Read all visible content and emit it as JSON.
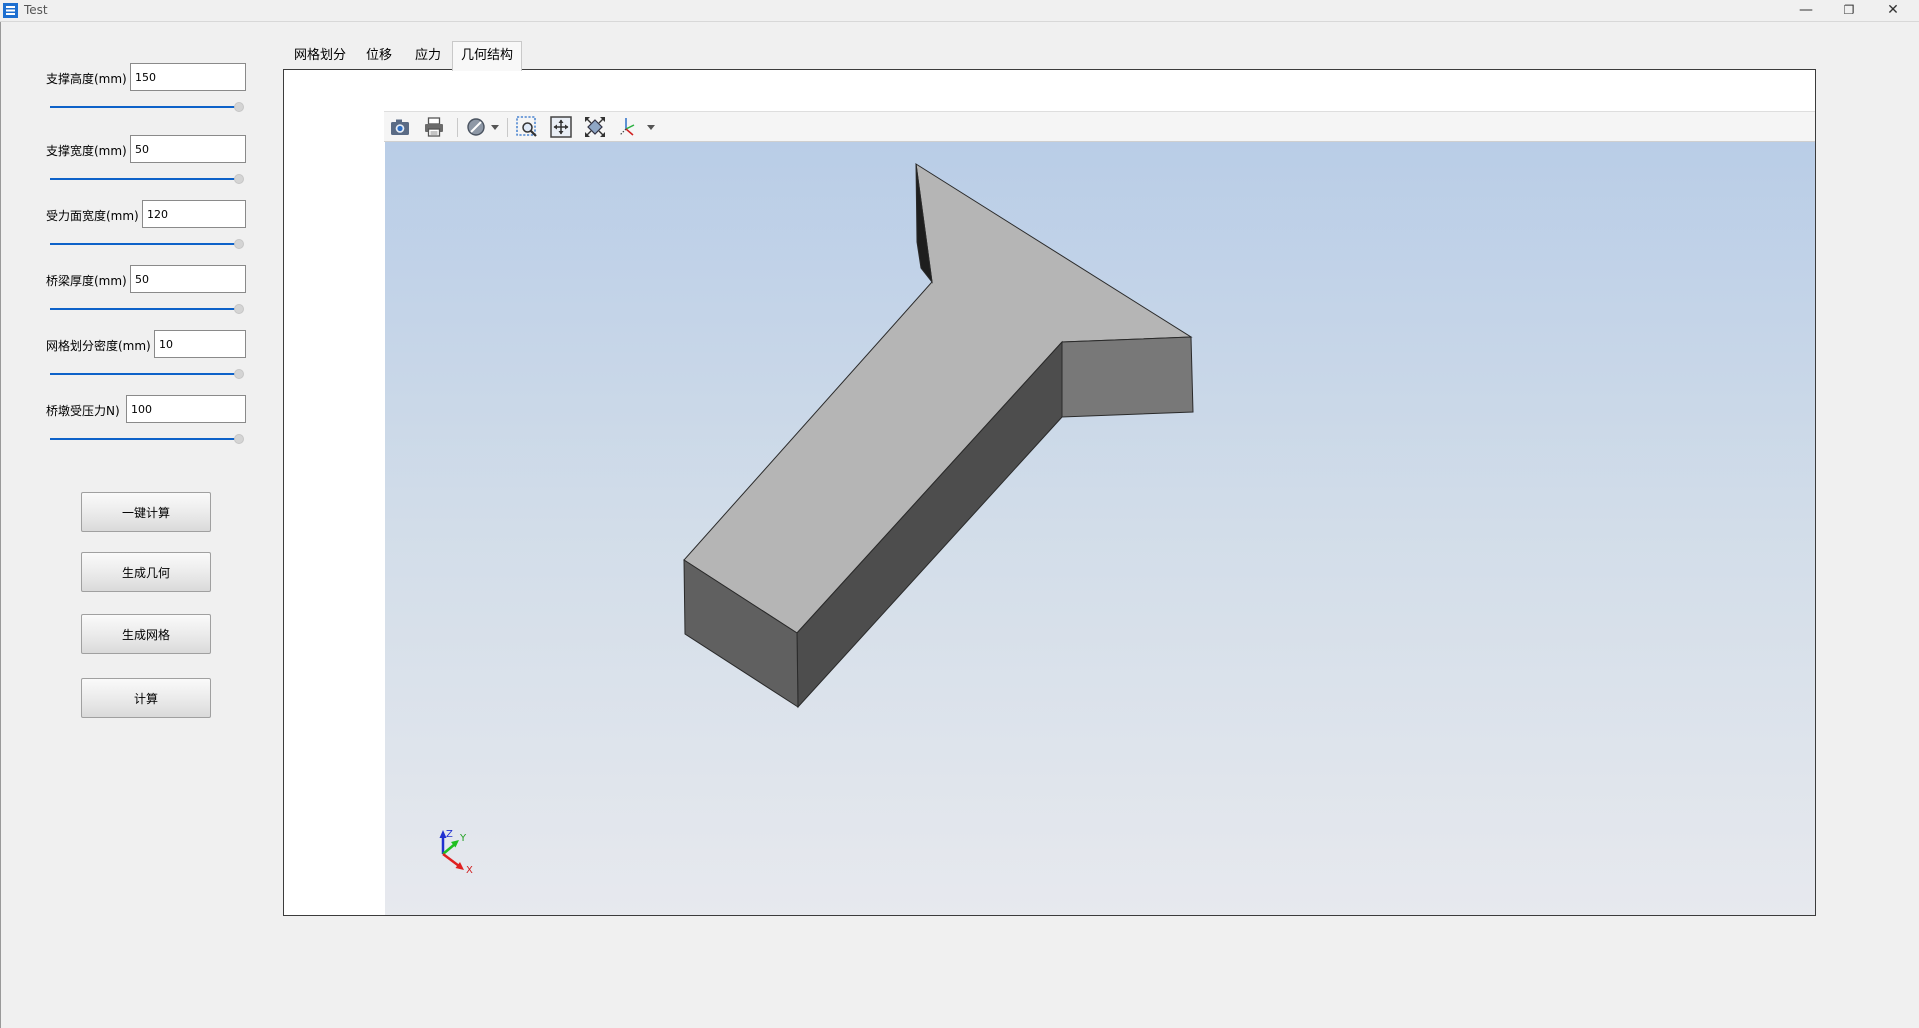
{
  "window": {
    "title": "Test",
    "controls": {
      "minimize": "—",
      "restore": "❐",
      "close": "✕"
    }
  },
  "params": [
    {
      "label": "支撑高度(mm)",
      "value": "150",
      "slider_fraction": 1.0
    },
    {
      "label": "支撑宽度(mm)",
      "value": "50",
      "slider_fraction": 1.0
    },
    {
      "label": "受力面宽度(mm)",
      "value": "120",
      "slider_fraction": 1.0
    },
    {
      "label": "桥梁厚度(mm)",
      "value": "50",
      "slider_fraction": 1.0
    },
    {
      "label": "网格划分密度(mm)",
      "value": "10",
      "slider_fraction": 1.0
    },
    {
      "label": "桥墩受压力N)",
      "value": "100",
      "slider_fraction": 1.0
    }
  ],
  "buttons": {
    "one_click": "一键计算",
    "gen_geometry": "生成几何",
    "gen_mesh": "生成网格",
    "compute": "计算"
  },
  "tabs": [
    {
      "label": "网格划分",
      "active": false
    },
    {
      "label": "位移",
      "active": false
    },
    {
      "label": "应力",
      "active": false
    },
    {
      "label": "几何结构",
      "active": true
    }
  ],
  "toolbar": {
    "icons": [
      "camera-icon",
      "print-icon",
      "display-mode-icon",
      "zoom-box-icon",
      "fit-all-icon",
      "zoom-extents-icon",
      "axes-view-icon"
    ]
  },
  "viewport": {
    "background_top": "#b9cde7",
    "background_bottom": "#e7e9ee",
    "axes": {
      "x": "X",
      "y": "Y",
      "z": "Z"
    },
    "axis_colors": {
      "x": "#e02020",
      "y": "#20c020",
      "z": "#2030d0"
    },
    "model_colors": {
      "top": "#b5b5b5",
      "side_dark": "#4d4d4d",
      "front": "#606060",
      "end": "#787878",
      "inner": "#1e1e1e"
    }
  }
}
